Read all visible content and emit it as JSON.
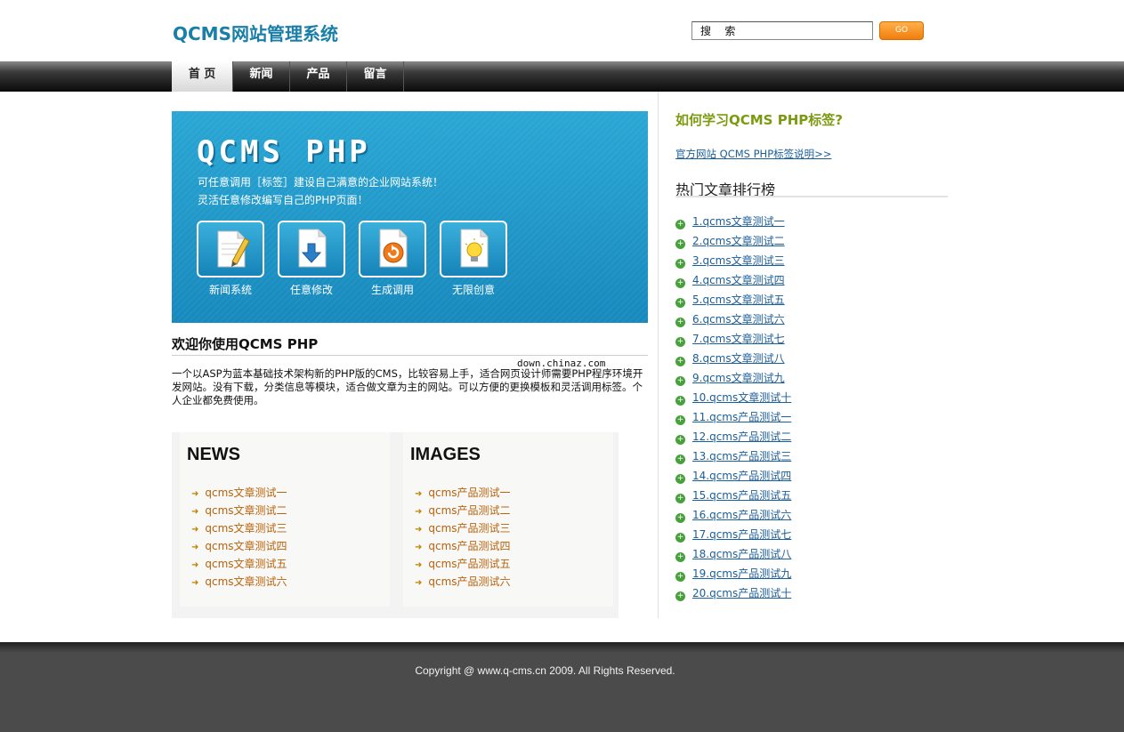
{
  "header": {
    "logo": "QCMS网站管理系统",
    "search_value": "搜 索",
    "go_label": "GO"
  },
  "nav": {
    "items": [
      {
        "label": "首 页",
        "active": true
      },
      {
        "label": "新闻",
        "active": false
      },
      {
        "label": "产品",
        "active": false
      },
      {
        "label": "留言",
        "active": false
      }
    ]
  },
  "banner": {
    "title": "QCMS PHP",
    "line1": "可任意调用［标签］建设自己满意的企业网站系统！",
    "line2": "灵活任意修改编写自己的PHP页面！",
    "features": [
      {
        "label": "新闻系统",
        "icon": "pencil-note-icon"
      },
      {
        "label": "任意修改",
        "icon": "download-doc-icon"
      },
      {
        "label": "生成调用",
        "icon": "refresh-doc-icon"
      },
      {
        "label": "无限创意",
        "icon": "lightbulb-doc-icon"
      }
    ]
  },
  "welcome": {
    "title": "欢迎你使用QCMS PHP",
    "watermark": "down.chinaz.com",
    "text": "一个以ASP为蓝本基础技术架构新的PHP版的CMS，比较容易上手，适合网页设计师需要PHP程序环境开发网站。没有下载，分类信息等模块，适合做文章为主的网站。可以方便的更换模板和灵活调用标签。个人企业都免费使用。"
  },
  "news": {
    "title": "NEWS",
    "items": [
      "qcms文章测试一",
      "qcms文章测试二",
      "qcms文章测试三",
      "qcms文章测试四",
      "qcms文章测试五",
      "qcms文章测试六"
    ]
  },
  "images": {
    "title": "IMAGES",
    "items": [
      "qcms产品测试一",
      "qcms产品测试二",
      "qcms产品测试三",
      "qcms产品测试四",
      "qcms产品测试五",
      "qcms产品测试六"
    ]
  },
  "sidebar": {
    "heading": "如何学习QCMS PHP标签?",
    "link": "官方网站 QCMS PHP标签说明>>",
    "hot_title": "热门文章排行榜",
    "ranking": [
      "1.qcms文章测试一",
      "2.qcms文章测试二",
      "3.qcms文章测试三",
      "4.qcms文章测试四",
      "5.qcms文章测试五",
      "6.qcms文章测试六",
      "7.qcms文章测试七",
      "8.qcms文章测试八",
      "9.qcms文章测试九",
      "10.qcms文章测试十",
      "11.qcms产品测试一",
      "12.qcms产品测试二",
      "13.qcms产品测试三",
      "14.qcms产品测试四",
      "15.qcms产品测试五",
      "16.qcms产品测试六",
      "17.qcms产品测试七",
      "18.qcms产品测试八",
      "19.qcms产品测试九",
      "20.qcms产品测试十"
    ]
  },
  "footer": {
    "copyright": "Copyright @ www.q-cms.cn 2009. All Rights Reserved."
  },
  "colors": {
    "brand": "#1a7fa8",
    "banner": "#1d95c8",
    "sidebar_heading": "#7c9a10",
    "list_text": "#b8620b",
    "link": "#1a5e9a",
    "go_button": "#f58a1a",
    "footer": "#4b4b4b"
  }
}
